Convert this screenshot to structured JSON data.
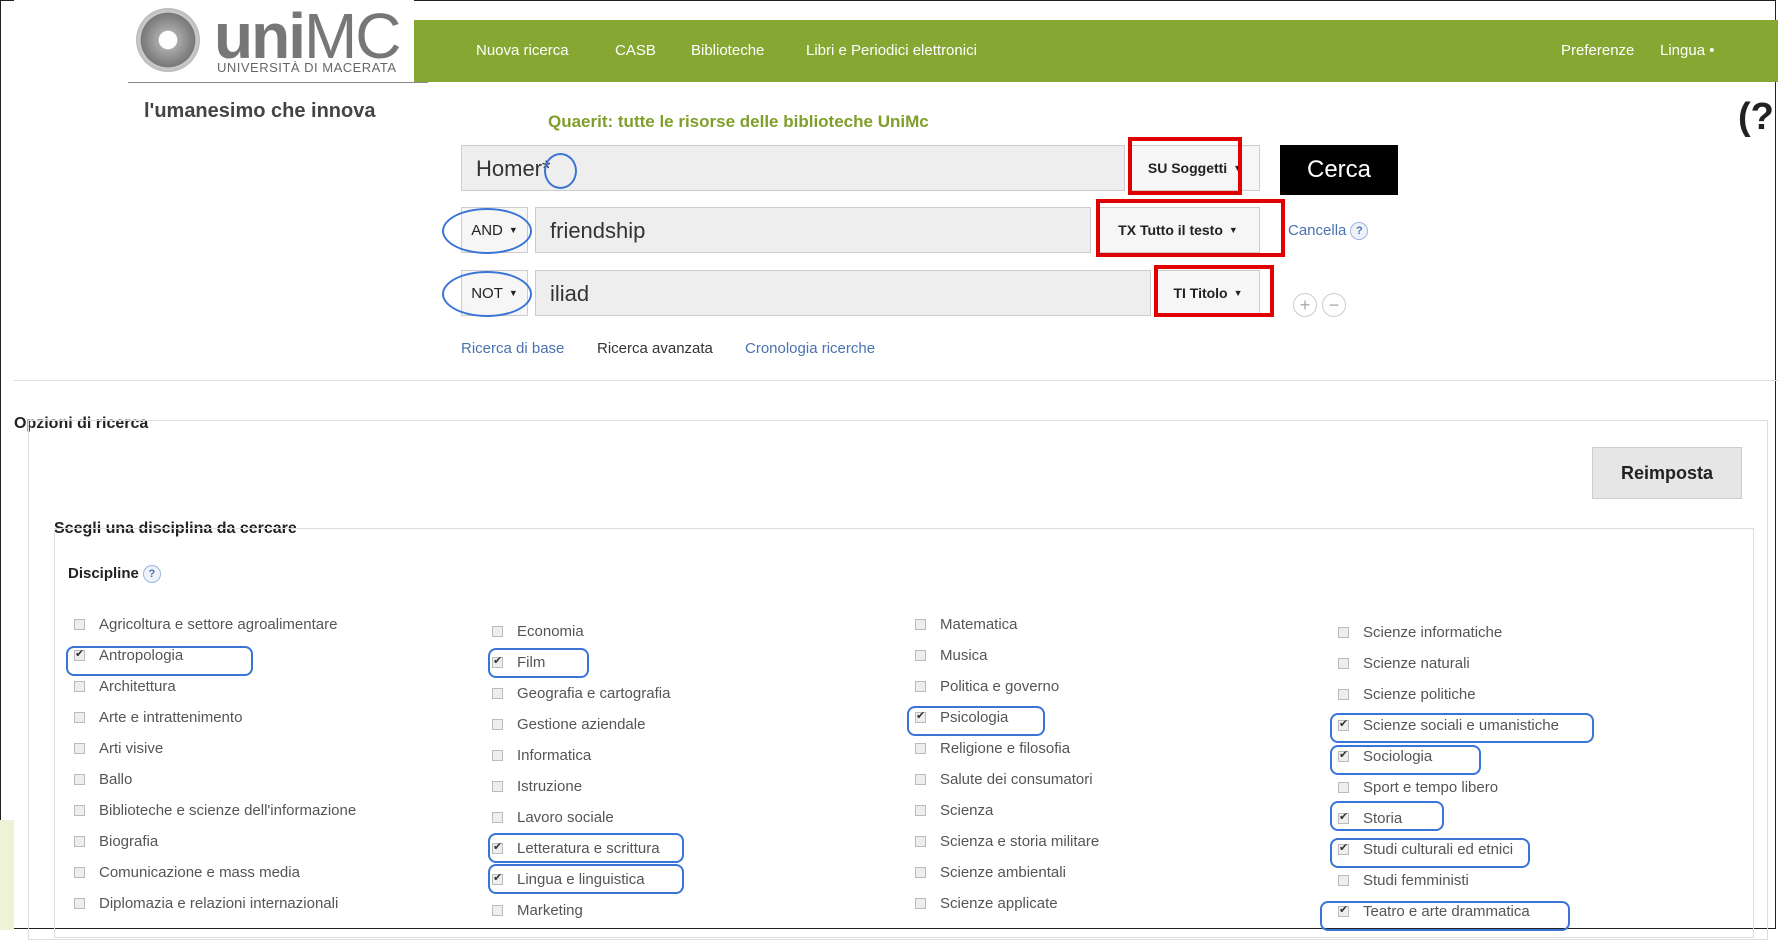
{
  "brand": {
    "name_bold": "uni",
    "name_light": "MC",
    "university": "UNIVERSITÀ DI MACERATA",
    "tagline": "l'umanesimo che innova"
  },
  "nav": {
    "items": [
      "Nuova ricerca",
      "CASB",
      "Biblioteche",
      "Libri e Periodici elettronici"
    ],
    "preferences": "Preferenze",
    "language": "Lingua",
    "language_caret": "•"
  },
  "search": {
    "subtitle": "Quaerit: tutte le risorse delle biblioteche UniMc",
    "rows": [
      {
        "operator": "",
        "value": "Homer*",
        "field": "SU Soggetti"
      },
      {
        "operator": "AND",
        "value": "friendship",
        "field": "TX Tutto il testo"
      },
      {
        "operator": "NOT",
        "value": "iliad",
        "field": "TI Titolo"
      }
    ],
    "submit": "Cerca",
    "clear": "Cancella",
    "help": "?",
    "add": "+",
    "remove": "−",
    "links": [
      "Ricerca di base",
      "Ricerca avanzata",
      "Cronologia ricerche"
    ],
    "caret": "▼"
  },
  "options": {
    "title": "Opzioni di ricerca",
    "reset": "Reimposta",
    "discipline_section": "Scegli una disciplina da cercare",
    "discipline_label": "Discipline",
    "columns": [
      [
        {
          "label": "Agricoltura e settore agroalimentare",
          "checked": false
        },
        {
          "label": "Antropologia",
          "checked": true
        },
        {
          "label": "Architettura",
          "checked": false
        },
        {
          "label": "Arte e intrattenimento",
          "checked": false
        },
        {
          "label": "Arti visive",
          "checked": false
        },
        {
          "label": "Ballo",
          "checked": false
        },
        {
          "label": "Biblioteche e scienze dell'informazione",
          "checked": false
        },
        {
          "label": "Biografia",
          "checked": false
        },
        {
          "label": "Comunicazione e mass media",
          "checked": false
        },
        {
          "label": "Diplomazia e relazioni internazionali",
          "checked": false
        }
      ],
      [
        {
          "label": "Economia",
          "checked": false
        },
        {
          "label": "Film",
          "checked": true
        },
        {
          "label": "Geografia e cartografia",
          "checked": false
        },
        {
          "label": "Gestione aziendale",
          "checked": false
        },
        {
          "label": "Informatica",
          "checked": false
        },
        {
          "label": "Istruzione",
          "checked": false
        },
        {
          "label": "Lavoro sociale",
          "checked": false
        },
        {
          "label": "Letteratura e scrittura",
          "checked": true
        },
        {
          "label": "Lingua e linguistica",
          "checked": true
        },
        {
          "label": "Marketing",
          "checked": false
        }
      ],
      [
        {
          "label": "Matematica",
          "checked": false
        },
        {
          "label": "Musica",
          "checked": false
        },
        {
          "label": "Politica e governo",
          "checked": false
        },
        {
          "label": "Psicologia",
          "checked": true
        },
        {
          "label": "Religione e filosofia",
          "checked": false
        },
        {
          "label": "Salute dei consumatori",
          "checked": false
        },
        {
          "label": "Scienza",
          "checked": false
        },
        {
          "label": "Scienza e storia militare",
          "checked": false
        },
        {
          "label": "Scienze ambientali",
          "checked": false
        },
        {
          "label": "Scienze applicate",
          "checked": false
        }
      ],
      [
        {
          "label": "Scienze informatiche",
          "checked": false
        },
        {
          "label": "Scienze naturali",
          "checked": false
        },
        {
          "label": "Scienze politiche",
          "checked": false
        },
        {
          "label": "Scienze sociali e umanistiche",
          "checked": true
        },
        {
          "label": "Sociologia",
          "checked": true
        },
        {
          "label": "Sport e tempo libero",
          "checked": false
        },
        {
          "label": "Storia",
          "checked": true
        },
        {
          "label": "Studi culturali ed etnici",
          "checked": true
        },
        {
          "label": "Studi femministi",
          "checked": false
        },
        {
          "label": "Teatro e arte drammatica",
          "checked": true
        }
      ]
    ]
  },
  "colors": {
    "nav_green": "#86a833",
    "subtitle_green": "#7f9e2a",
    "annotation_red": "#e00000",
    "annotation_blue": "#3a74d6",
    "link_blue": "#4a72b0"
  }
}
